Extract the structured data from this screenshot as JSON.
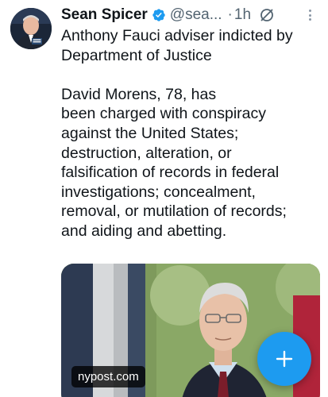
{
  "tweet": {
    "author": {
      "display_name": "Sean Spicer",
      "handle": "@sea...",
      "verified": true,
      "avatar_icon": "avatar-photo"
    },
    "time": "1h",
    "separator": "·",
    "header_icons": [
      "verified-badge-icon",
      "grok-icon",
      "more-options-icon"
    ],
    "text_lines_block1": [
      "Anthony Fauci adviser indicted by",
      "Department of Justice"
    ],
    "text_lines_block2": [
      "David Morens, 78, has",
      "been charged with conspiracy",
      "against the United States;",
      "destruction, alteration, or",
      "falsification of records in federal",
      "investigations; concealment,",
      "removal, or mutilation of records;",
      "and aiding and abetting."
    ],
    "media": {
      "source_label": "nypost.com"
    }
  },
  "compose_button": {
    "icon": "plus-icon"
  },
  "colors": {
    "accent": "#1d9bf0",
    "text_primary": "#0f1419",
    "text_secondary": "#536471"
  }
}
